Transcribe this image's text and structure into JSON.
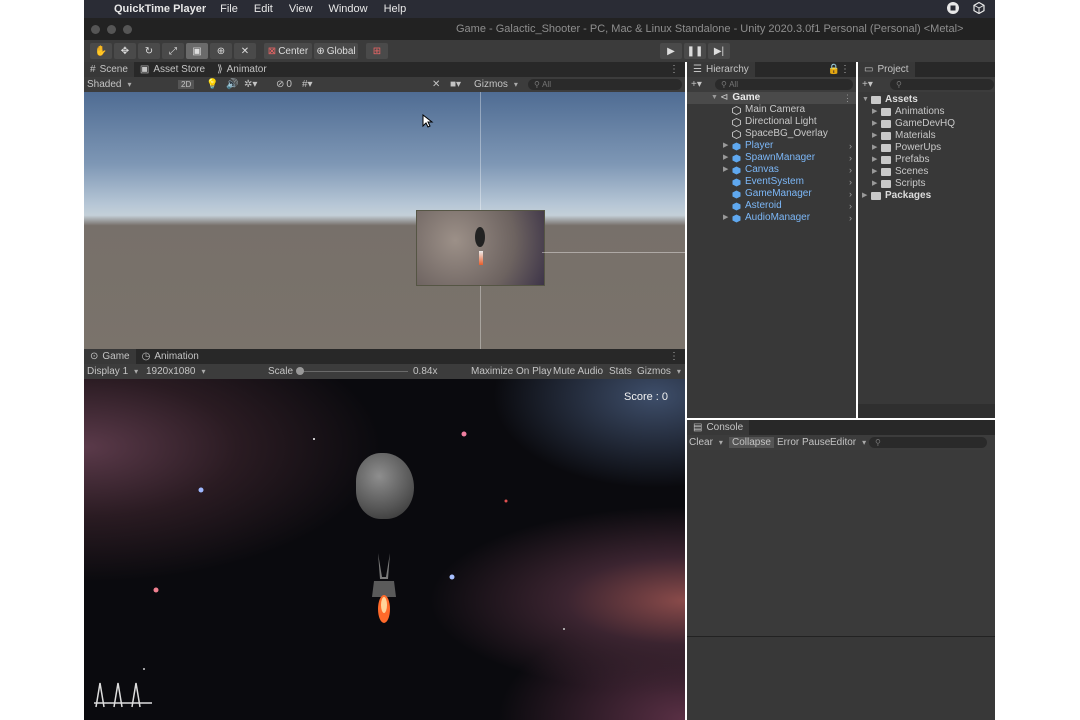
{
  "menubar": {
    "app_name": "QuickTime Player",
    "items": [
      "File",
      "Edit",
      "View",
      "Window",
      "Help"
    ]
  },
  "window": {
    "title": "Game - Galactic_Shooter - PC, Mac & Linux Standalone - Unity 2020.3.0f1 Personal (Personal) <Metal>"
  },
  "toolbar": {
    "pivot_label": "Center",
    "space_label": "Global"
  },
  "scene_panel": {
    "tabs": [
      "Scene",
      "Asset Store",
      "Animator"
    ],
    "shading_mode": "Shaded",
    "mode_2d": "2D",
    "hidden_count": "0",
    "gizmos_label": "Gizmos",
    "search_placeholder": "All"
  },
  "game_panel": {
    "tabs": [
      "Game",
      "Animation"
    ],
    "display": "Display 1",
    "resolution": "1920x1080",
    "scale_label": "Scale",
    "scale_value": "0.84x",
    "scale_fraction": 0.02,
    "maximize_label": "Maximize On Play",
    "mute_label": "Mute Audio",
    "stats_label": "Stats",
    "gizmos_label": "Gizmos",
    "score_text": "Score : 0"
  },
  "hierarchy": {
    "tab_label": "Hierarchy",
    "search_placeholder": "All",
    "root": "Game",
    "items": [
      {
        "label": "Main Camera",
        "prefab": false,
        "expandable": false
      },
      {
        "label": "Directional Light",
        "prefab": false,
        "expandable": false
      },
      {
        "label": "SpaceBG_Overlay",
        "prefab": false,
        "expandable": false
      },
      {
        "label": "Player",
        "prefab": true,
        "expandable": true
      },
      {
        "label": "SpawnManager",
        "prefab": true,
        "expandable": true
      },
      {
        "label": "Canvas",
        "prefab": true,
        "expandable": true
      },
      {
        "label": "EventSystem",
        "prefab": true,
        "expandable": false
      },
      {
        "label": "GameManager",
        "prefab": true,
        "expandable": false
      },
      {
        "label": "Asteroid",
        "prefab": true,
        "expandable": false
      },
      {
        "label": "AudioManager",
        "prefab": true,
        "expandable": true
      }
    ]
  },
  "project": {
    "tab_label": "Project",
    "assets_label": "Assets",
    "folders": [
      "Animations",
      "GameDevHQ",
      "Materials",
      "PowerUps",
      "Prefabs",
      "Scenes",
      "Scripts"
    ],
    "packages_label": "Packages"
  },
  "console": {
    "tab_label": "Console",
    "clear_label": "Clear",
    "collapse_label": "Collapse",
    "error_pause_label": "Error Pause",
    "editor_label": "Editor"
  },
  "icons": {
    "play": "play-icon",
    "pause": "pause-icon",
    "step": "step-icon"
  }
}
